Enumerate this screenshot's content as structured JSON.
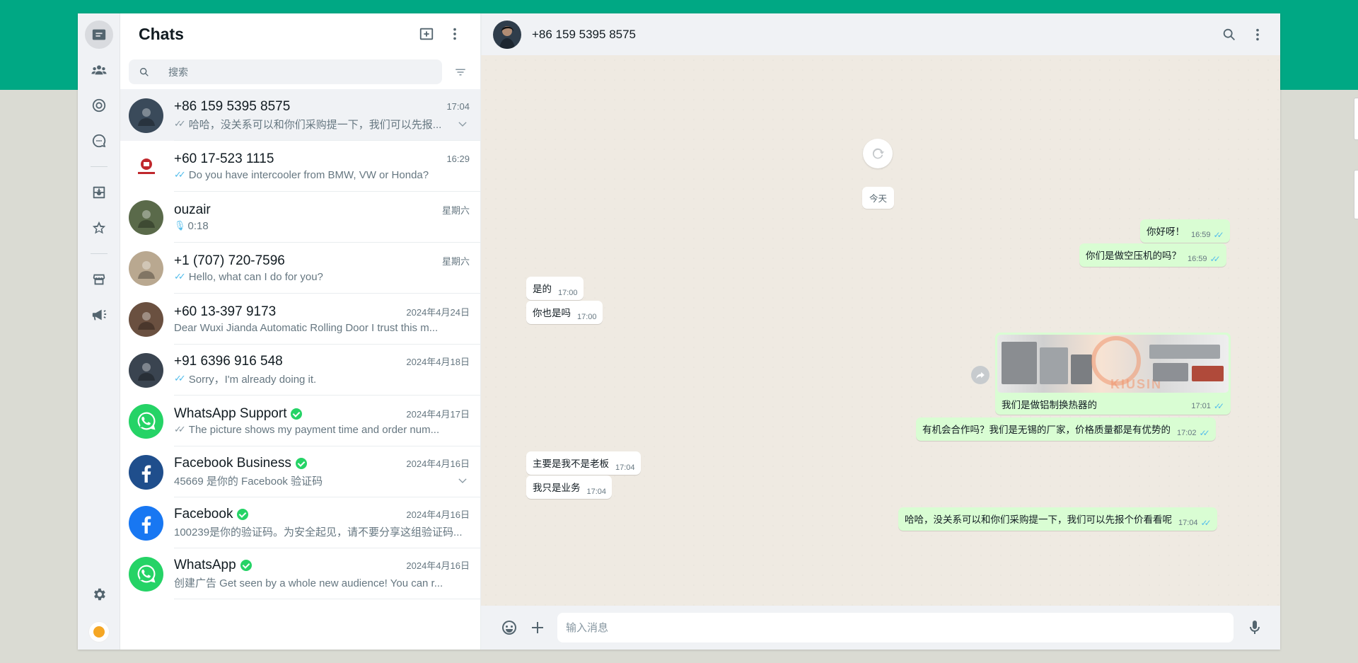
{
  "sidebar": {
    "title": "Chats",
    "search_placeholder": "搜索"
  },
  "chats": [
    {
      "name": "+86 159 5395 8575",
      "time": "17:04",
      "preview": "哈哈，没关系可以和你们采购提一下，我们可以先报...",
      "tick": "✓✓",
      "tick_color": "#8696a0",
      "avatar_color": "#3a4a5a",
      "active": true,
      "chevron": true
    },
    {
      "name": "+60 17-523 1115",
      "time": "16:29",
      "preview": "Do you have intercooler from BMW, VW or Honda?",
      "tick": "✓✓",
      "tick_color": "#53bdeb",
      "avatar_color": "#ffffff"
    },
    {
      "name": "ouzair",
      "time": "星期六",
      "preview": "0:18",
      "mic": true,
      "avatar_color": "#5a6a4a"
    },
    {
      "name": "+1 (707) 720-7596",
      "time": "星期六",
      "preview": "Hello, what can I do for you?",
      "tick": "✓✓",
      "tick_color": "#53bdeb",
      "avatar_color": "#b9a890"
    },
    {
      "name": "+60 13-397 9173",
      "time": "2024年4月24日",
      "preview": "Dear Wuxi Jianda Automatic Rolling Door  I trust this m...",
      "avatar_color": "#6a5040"
    },
    {
      "name": "+91 6396 916 548",
      "time": "2024年4月18日",
      "preview": "Sorry，I'm already doing it.",
      "tick": "✓✓",
      "tick_color": "#53bdeb",
      "avatar_color": "#3a4450"
    },
    {
      "name": "WhatsApp Support",
      "time": "2024年4月17日",
      "preview": "The picture shows my payment time and order num...",
      "tick": "✓✓",
      "tick_color": "#8696a0",
      "avatar_color": "#25d366",
      "verified": true,
      "icon": "whatsapp-logo-icon"
    },
    {
      "name": "Facebook Business",
      "time": "2024年4月16日",
      "preview": "45669 是你的 Facebook 验证码",
      "avatar_color": "#1f4e8c",
      "verified": true,
      "chevron": true,
      "icon": "facebook-logo-icon"
    },
    {
      "name": "Facebook",
      "time": "2024年4月16日",
      "preview": "100239是你的验证码。为安全起见，请不要分享这组验证码...",
      "avatar_color": "#1877f2",
      "verified": true,
      "icon": "facebook-logo-icon"
    },
    {
      "name": "WhatsApp",
      "time": "2024年4月16日",
      "preview": "创建广告 Get seen by a whole new audience!  You can r...",
      "avatar_color": "#25d366",
      "verified": true,
      "icon": "whatsapp-logo-icon"
    }
  ],
  "conversation": {
    "contact": "+86 159 5395 8575",
    "date_chip": "今天",
    "messages": {
      "m1": {
        "text": "你好呀！",
        "time": "16:59",
        "tick": "✓✓"
      },
      "m2": {
        "text": "你们是做空压机的吗？",
        "time": "16:59",
        "tick": "✓✓"
      },
      "m3": {
        "text": "是的",
        "time": "17:00"
      },
      "m4": {
        "text": "你也是吗",
        "time": "17:00"
      },
      "m5": {
        "text": "我们是做铝制换热器的",
        "time": "17:01",
        "tick": "✓✓"
      },
      "m6": {
        "text": "有机会合作吗？我们是无锡的厂家，价格质量都是有优势的",
        "time": "17:02",
        "tick": "✓✓"
      },
      "m7": {
        "text": "主要是我不是老板",
        "time": "17:04"
      },
      "m8": {
        "text": "我只是业务",
        "time": "17:04"
      },
      "m9": {
        "text": "哈哈，没关系可以和你们采购提一下，我们可以先报个价看看呢",
        "time": "17:04",
        "tick": "✓✓"
      }
    },
    "image_brand": "KIUSIN",
    "input_placeholder": "输入消息"
  },
  "colors": {
    "brand_green": "#00a884",
    "outgoing_bubble": "#d9fdd3",
    "read_tick": "#53bdeb"
  }
}
